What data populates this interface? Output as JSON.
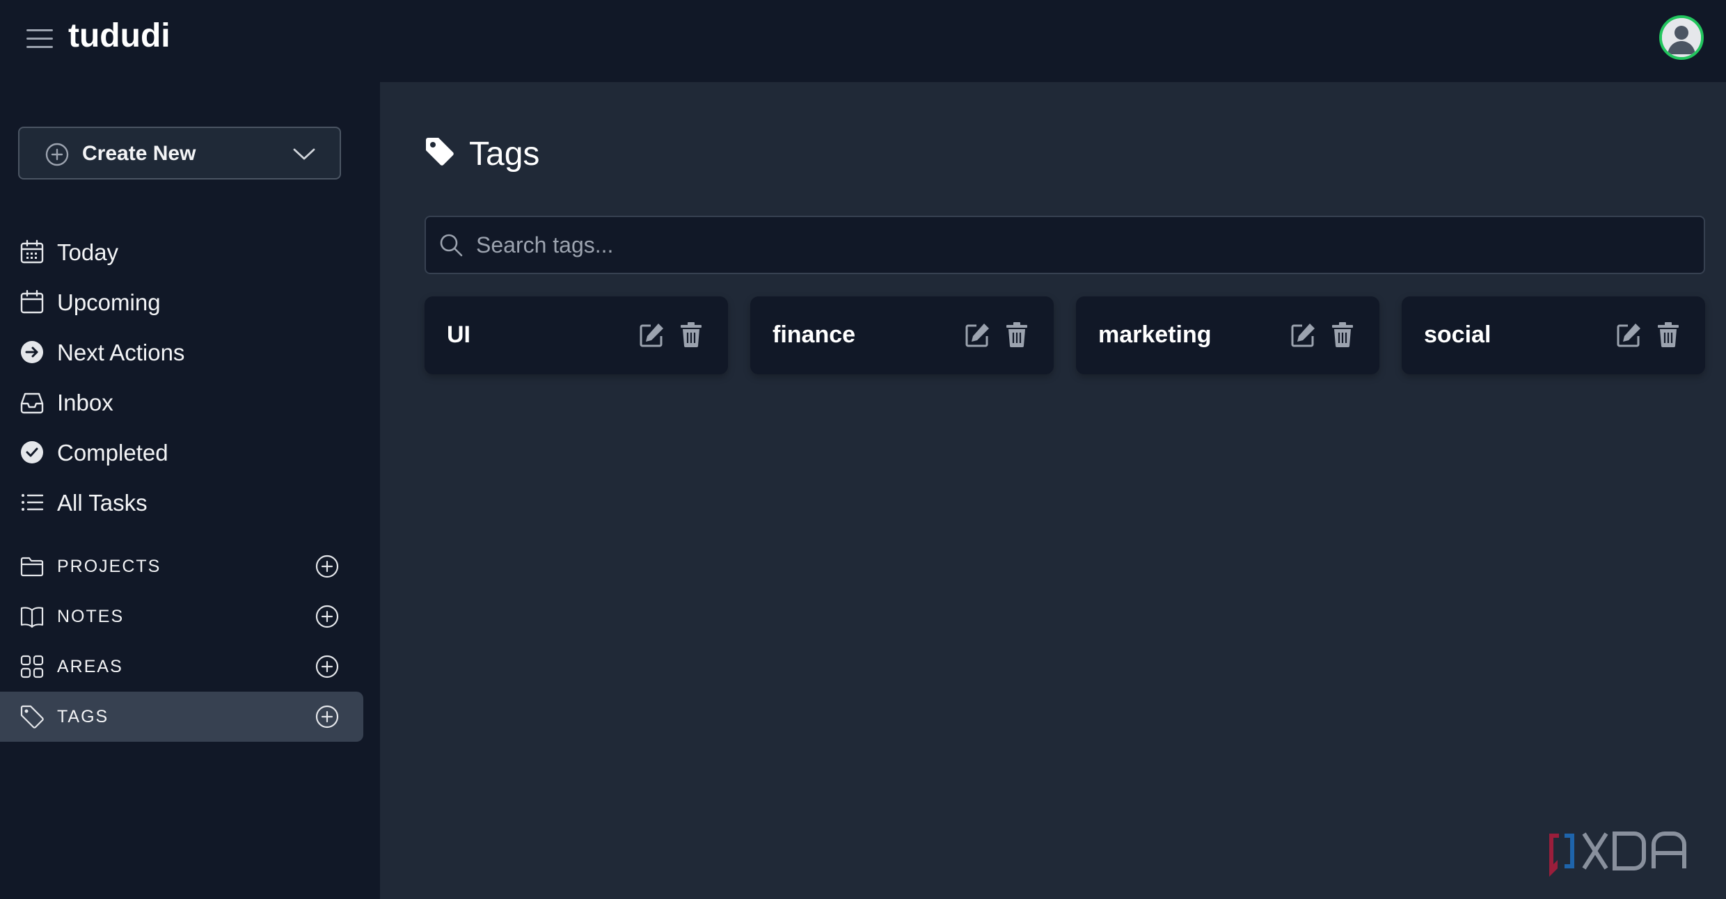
{
  "app": {
    "title": "tududi"
  },
  "header": {
    "menu_icon": "hamburger-icon",
    "avatar_icon": "user-avatar-icon",
    "avatar_ring_color": "#22c55e"
  },
  "sidebar": {
    "create_new": {
      "label": "Create New"
    },
    "nav": [
      {
        "label": "Today",
        "icon": "calendar-today-icon"
      },
      {
        "label": "Upcoming",
        "icon": "calendar-icon"
      },
      {
        "label": "Next Actions",
        "icon": "arrow-circle-right-icon"
      },
      {
        "label": "Inbox",
        "icon": "inbox-icon"
      },
      {
        "label": "Completed",
        "icon": "check-circle-icon"
      },
      {
        "label": "All Tasks",
        "icon": "list-icon"
      }
    ],
    "sections": [
      {
        "label": "PROJECTS",
        "icon": "folder-icon",
        "active": false
      },
      {
        "label": "NOTES",
        "icon": "book-icon",
        "active": false
      },
      {
        "label": "AREAS",
        "icon": "grid-icon",
        "active": false
      },
      {
        "label": "TAGS",
        "icon": "tag-icon",
        "active": true
      }
    ]
  },
  "main": {
    "title": "Tags",
    "search": {
      "placeholder": "Search tags...",
      "value": ""
    },
    "tags": [
      {
        "name": "UI"
      },
      {
        "name": "finance"
      },
      {
        "name": "marketing"
      },
      {
        "name": "social"
      }
    ]
  },
  "colors": {
    "sidebar_bg": "#111827",
    "main_bg": "#202937",
    "active_bg": "#374151",
    "text": "#f3f4f6",
    "icon_muted": "#9ca3af"
  }
}
